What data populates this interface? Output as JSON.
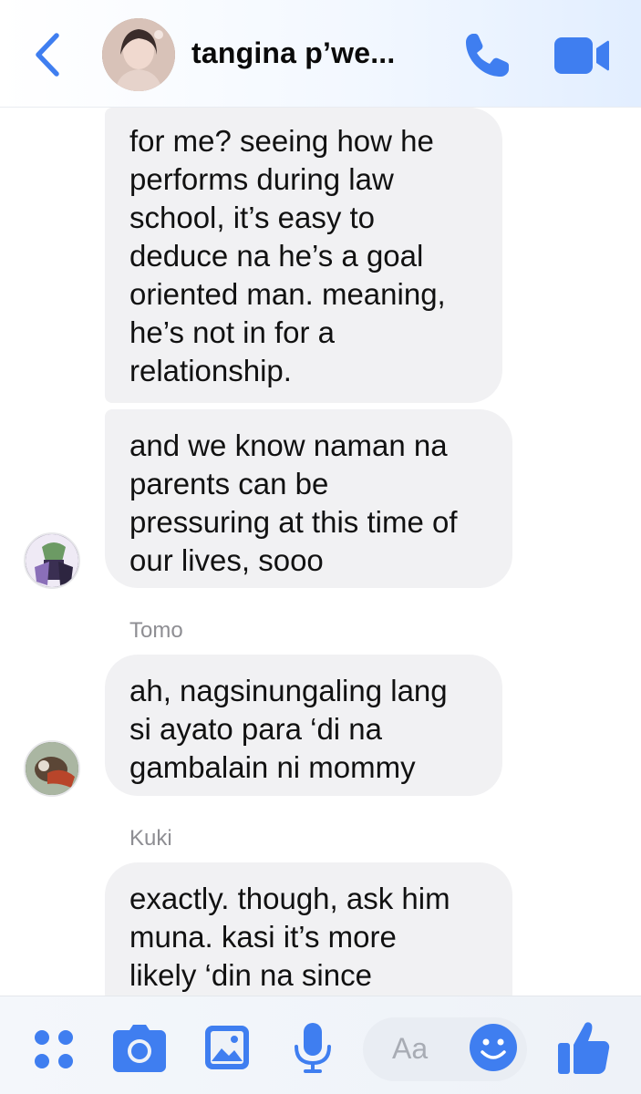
{
  "header": {
    "title": "tangina p’we...",
    "back_icon": "chevron-left-icon",
    "call_icon": "phone-icon",
    "video_icon": "video-camera-icon",
    "accent": "#3f7ef0"
  },
  "messages": [
    {
      "sender": "",
      "text": "for me? seeing how he\nperforms during law\nschool, it’s easy to\ndeduce na he’s a goal\noriented man. meaning,\nhe’s not in for a\nrelationship."
    },
    {
      "sender": "",
      "text": "and we know naman na\nparents can be\npressuring at this time of\nour lives, sooo"
    },
    {
      "sender": "Tomo",
      "text": "ah, nagsinungaling lang\nsi ayato para ‘di na\ngambalain ni mommy"
    },
    {
      "sender": "Kuki",
      "text": "exactly. though, ask him\nmuna. kasi it’s more\nlikely ‘din na since"
    }
  ],
  "composer": {
    "placeholder": "Aa",
    "icons": [
      "apps-icon",
      "camera-icon",
      "image-icon",
      "microphone-icon",
      "emoji-icon",
      "thumbs-up-icon"
    ]
  },
  "colors": {
    "bubble": "#f1f1f3",
    "name": "#8e8e93",
    "icon_blue": "#3f7ef0"
  }
}
